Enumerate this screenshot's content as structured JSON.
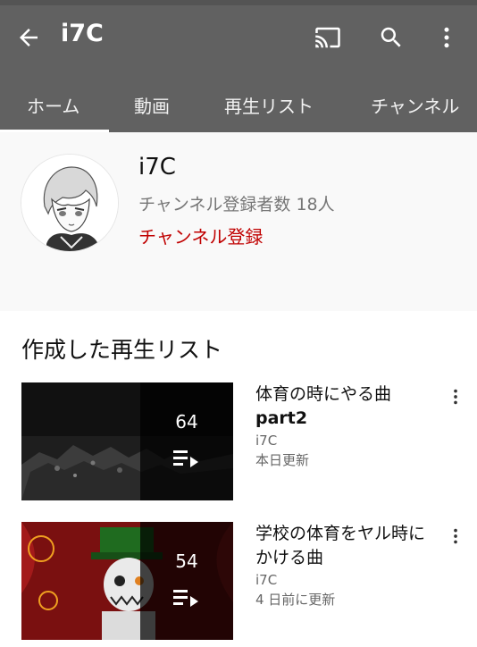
{
  "appbar": {
    "title": "i7C",
    "icons": [
      "back-arrow-icon",
      "cast-icon",
      "search-icon",
      "more-vert-icon"
    ]
  },
  "tabs": [
    {
      "label": "ホーム",
      "active": true
    },
    {
      "label": "動画"
    },
    {
      "label": "再生リスト"
    },
    {
      "label": "チャンネル"
    }
  ],
  "channel": {
    "name": "i7C",
    "subscribers": "チャンネル登録者数 18人",
    "subscribe_label": "チャンネル登録"
  },
  "section": {
    "title": "作成した再生リスト"
  },
  "playlists": [
    {
      "title_line1": "体育の時にやる曲",
      "title_line2": "part2",
      "count": "64",
      "author": "i7C",
      "updated": "本日更新"
    },
    {
      "title_line1": "学校の体育をヤル時に",
      "title_line2": "かける曲",
      "count": "54",
      "author": "i7C",
      "updated": "4 日前に更新"
    }
  ],
  "colors": {
    "appbar": "#616161",
    "subscribe": "#c00000",
    "channel_bg": "#f9f9f9"
  }
}
